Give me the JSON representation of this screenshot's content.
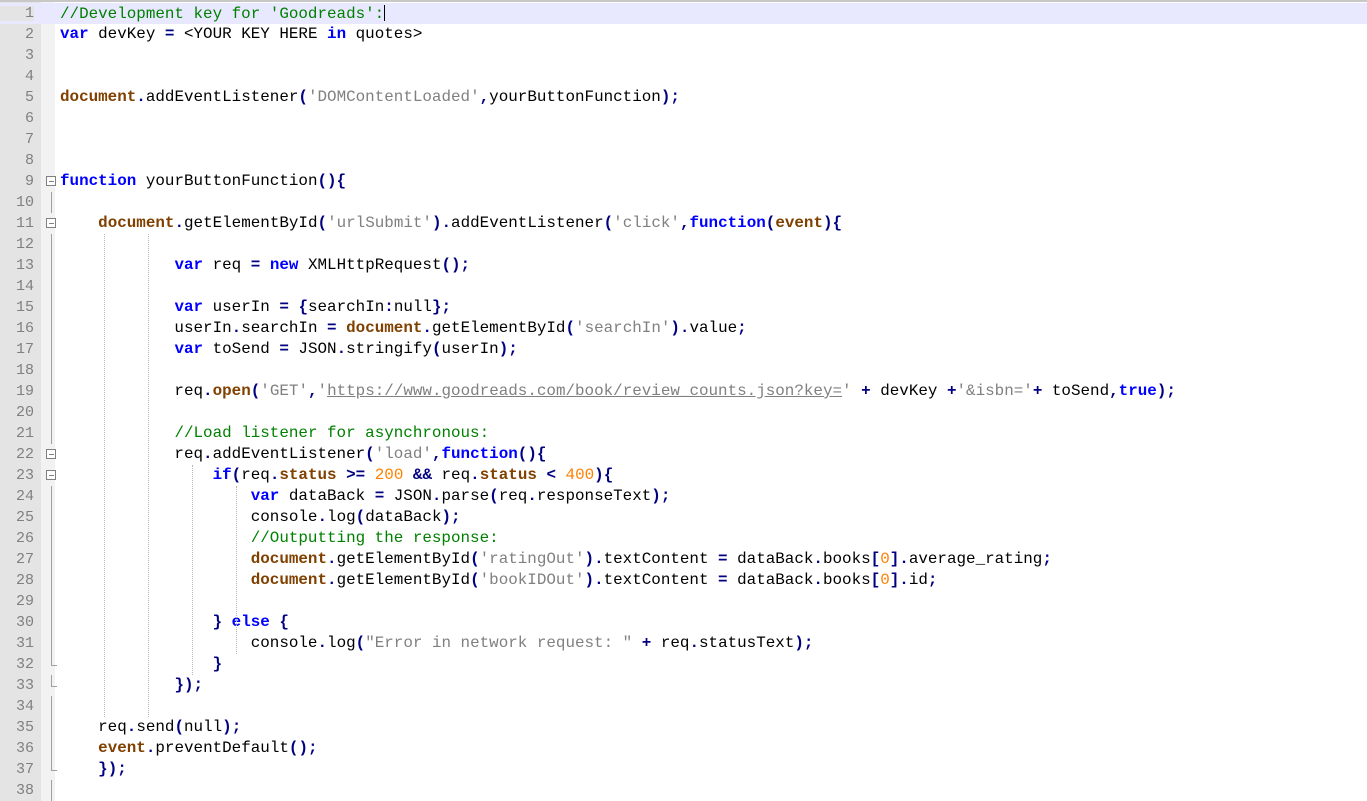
{
  "editor": {
    "language": "javascript",
    "current_line": 1,
    "colors": {
      "keyword": "#0000ff",
      "object": "#804000",
      "string": "#808080",
      "comment": "#008000",
      "number": "#ff8000",
      "operator": "#000080",
      "gutter": "#e4e4e4",
      "current_line": "#e8e8ff"
    },
    "lines": [
      {
        "num": "1",
        "fold": "",
        "tokens": [
          [
            "com",
            "//Development key for 'Goodreads':"
          ]
        ]
      },
      {
        "num": "2",
        "fold": "",
        "tokens": [
          [
            "kw",
            "var"
          ],
          [
            "plain",
            " devKey "
          ],
          [
            "op",
            "="
          ],
          [
            "plain",
            " <YOUR KEY HERE "
          ],
          [
            "kw",
            "in"
          ],
          [
            "plain",
            " quotes>"
          ]
        ]
      },
      {
        "num": "3",
        "fold": "",
        "tokens": []
      },
      {
        "num": "4",
        "fold": "",
        "tokens": []
      },
      {
        "num": "5",
        "fold": "",
        "tokens": [
          [
            "obj",
            "document"
          ],
          [
            "op",
            "."
          ],
          [
            "plain",
            "addEventListener"
          ],
          [
            "op",
            "("
          ],
          [
            "str",
            "'DOMContentLoaded'"
          ],
          [
            "op",
            ","
          ],
          [
            "plain",
            "yourButtonFunction"
          ],
          [
            "op",
            ");"
          ]
        ]
      },
      {
        "num": "6",
        "fold": "",
        "tokens": []
      },
      {
        "num": "7",
        "fold": "",
        "tokens": []
      },
      {
        "num": "8",
        "fold": "",
        "tokens": []
      },
      {
        "num": "9",
        "fold": "box",
        "tokens": [
          [
            "kw",
            "function"
          ],
          [
            "plain",
            " yourButtonFunction"
          ],
          [
            "op",
            "(){"
          ]
        ]
      },
      {
        "num": "10",
        "fold": "line",
        "tokens": []
      },
      {
        "num": "11",
        "fold": "box",
        "tokens": [
          [
            "plain",
            "    "
          ],
          [
            "obj",
            "document"
          ],
          [
            "op",
            "."
          ],
          [
            "plain",
            "getElementById"
          ],
          [
            "op",
            "("
          ],
          [
            "str",
            "'urlSubmit'"
          ],
          [
            "op",
            ")."
          ],
          [
            "plain",
            "addEventListener"
          ],
          [
            "op",
            "("
          ],
          [
            "str",
            "'click'"
          ],
          [
            "op",
            ","
          ],
          [
            "kw",
            "function"
          ],
          [
            "op",
            "("
          ],
          [
            "obj",
            "event"
          ],
          [
            "op",
            "){"
          ]
        ]
      },
      {
        "num": "12",
        "fold": "line",
        "tokens": []
      },
      {
        "num": "13",
        "fold": "line",
        "tokens": [
          [
            "plain",
            "            "
          ],
          [
            "kw",
            "var"
          ],
          [
            "plain",
            " req "
          ],
          [
            "op",
            "="
          ],
          [
            "plain",
            " "
          ],
          [
            "kw",
            "new"
          ],
          [
            "plain",
            " XMLHttpRequest"
          ],
          [
            "op",
            "();"
          ]
        ]
      },
      {
        "num": "14",
        "fold": "line",
        "tokens": []
      },
      {
        "num": "15",
        "fold": "line",
        "tokens": [
          [
            "plain",
            "            "
          ],
          [
            "kw",
            "var"
          ],
          [
            "plain",
            " userIn "
          ],
          [
            "op",
            "="
          ],
          [
            "plain",
            " "
          ],
          [
            "op",
            "{"
          ],
          [
            "plain",
            "searchIn"
          ],
          [
            "op",
            ":"
          ],
          [
            "plain",
            "null"
          ],
          [
            "op",
            "};"
          ]
        ]
      },
      {
        "num": "16",
        "fold": "line",
        "tokens": [
          [
            "plain",
            "            userIn"
          ],
          [
            "op",
            "."
          ],
          [
            "plain",
            "searchIn "
          ],
          [
            "op",
            "="
          ],
          [
            "plain",
            " "
          ],
          [
            "obj",
            "document"
          ],
          [
            "op",
            "."
          ],
          [
            "plain",
            "getElementById"
          ],
          [
            "op",
            "("
          ],
          [
            "str",
            "'searchIn'"
          ],
          [
            "op",
            ")."
          ],
          [
            "plain",
            "value"
          ],
          [
            "op",
            ";"
          ]
        ]
      },
      {
        "num": "17",
        "fold": "line",
        "tokens": [
          [
            "plain",
            "            "
          ],
          [
            "kw",
            "var"
          ],
          [
            "plain",
            " toSend "
          ],
          [
            "op",
            "="
          ],
          [
            "plain",
            " JSON"
          ],
          [
            "op",
            "."
          ],
          [
            "plain",
            "stringify"
          ],
          [
            "op",
            "("
          ],
          [
            "plain",
            "userIn"
          ],
          [
            "op",
            ");"
          ]
        ]
      },
      {
        "num": "18",
        "fold": "line",
        "tokens": []
      },
      {
        "num": "19",
        "fold": "line",
        "tokens": [
          [
            "plain",
            "            req"
          ],
          [
            "op",
            "."
          ],
          [
            "obj",
            "open"
          ],
          [
            "op",
            "("
          ],
          [
            "str",
            "'GET'"
          ],
          [
            "op",
            ","
          ],
          [
            "str",
            "'"
          ],
          [
            "url",
            "https://www.goodreads.com/book/review_counts.json?key="
          ],
          [
            "str",
            "'"
          ],
          [
            "plain",
            " "
          ],
          [
            "op",
            "+"
          ],
          [
            "plain",
            " devKey "
          ],
          [
            "op",
            "+"
          ],
          [
            "str",
            "'&isbn='"
          ],
          [
            "op",
            "+"
          ],
          [
            "plain",
            " toSend"
          ],
          [
            "op",
            ","
          ],
          [
            "kw",
            "true"
          ],
          [
            "op",
            ");"
          ]
        ]
      },
      {
        "num": "20",
        "fold": "line",
        "tokens": []
      },
      {
        "num": "21",
        "fold": "line",
        "tokens": [
          [
            "plain",
            "            "
          ],
          [
            "com",
            "//Load listener for asynchronous:"
          ]
        ]
      },
      {
        "num": "22",
        "fold": "box",
        "tokens": [
          [
            "plain",
            "            req"
          ],
          [
            "op",
            "."
          ],
          [
            "plain",
            "addEventListener"
          ],
          [
            "op",
            "("
          ],
          [
            "str",
            "'load'"
          ],
          [
            "op",
            ","
          ],
          [
            "kw",
            "function"
          ],
          [
            "op",
            "(){"
          ]
        ]
      },
      {
        "num": "23",
        "fold": "box",
        "tokens": [
          [
            "plain",
            "                "
          ],
          [
            "kw",
            "if"
          ],
          [
            "op",
            "("
          ],
          [
            "plain",
            "req"
          ],
          [
            "op",
            "."
          ],
          [
            "obj",
            "status"
          ],
          [
            "plain",
            " "
          ],
          [
            "op",
            ">="
          ],
          [
            "plain",
            " "
          ],
          [
            "num",
            "200"
          ],
          [
            "plain",
            " "
          ],
          [
            "op",
            "&&"
          ],
          [
            "plain",
            " req"
          ],
          [
            "op",
            "."
          ],
          [
            "obj",
            "status"
          ],
          [
            "plain",
            " "
          ],
          [
            "op",
            "<"
          ],
          [
            "plain",
            " "
          ],
          [
            "num",
            "400"
          ],
          [
            "op",
            "){"
          ]
        ]
      },
      {
        "num": "24",
        "fold": "line",
        "tokens": [
          [
            "plain",
            "                    "
          ],
          [
            "kw",
            "var"
          ],
          [
            "plain",
            " dataBack "
          ],
          [
            "op",
            "="
          ],
          [
            "plain",
            " JSON"
          ],
          [
            "op",
            "."
          ],
          [
            "plain",
            "parse"
          ],
          [
            "op",
            "("
          ],
          [
            "plain",
            "req"
          ],
          [
            "op",
            "."
          ],
          [
            "plain",
            "responseText"
          ],
          [
            "op",
            ");"
          ]
        ]
      },
      {
        "num": "25",
        "fold": "line",
        "tokens": [
          [
            "plain",
            "                    console"
          ],
          [
            "op",
            "."
          ],
          [
            "plain",
            "log"
          ],
          [
            "op",
            "("
          ],
          [
            "plain",
            "dataBack"
          ],
          [
            "op",
            ");"
          ]
        ]
      },
      {
        "num": "26",
        "fold": "line",
        "tokens": [
          [
            "plain",
            "                    "
          ],
          [
            "com",
            "//Outputting the response:"
          ]
        ]
      },
      {
        "num": "27",
        "fold": "line",
        "tokens": [
          [
            "plain",
            "                    "
          ],
          [
            "obj",
            "document"
          ],
          [
            "op",
            "."
          ],
          [
            "plain",
            "getElementById"
          ],
          [
            "op",
            "("
          ],
          [
            "str",
            "'ratingOut'"
          ],
          [
            "op",
            ")."
          ],
          [
            "plain",
            "textContent "
          ],
          [
            "op",
            "="
          ],
          [
            "plain",
            " dataBack"
          ],
          [
            "op",
            "."
          ],
          [
            "plain",
            "books"
          ],
          [
            "op",
            "["
          ],
          [
            "num",
            "0"
          ],
          [
            "op",
            "]."
          ],
          [
            "plain",
            "average_rating"
          ],
          [
            "op",
            ";"
          ]
        ]
      },
      {
        "num": "28",
        "fold": "line",
        "tokens": [
          [
            "plain",
            "                    "
          ],
          [
            "obj",
            "document"
          ],
          [
            "op",
            "."
          ],
          [
            "plain",
            "getElementById"
          ],
          [
            "op",
            "("
          ],
          [
            "str",
            "'bookIDOut'"
          ],
          [
            "op",
            ")."
          ],
          [
            "plain",
            "textContent "
          ],
          [
            "op",
            "="
          ],
          [
            "plain",
            " dataBack"
          ],
          [
            "op",
            "."
          ],
          [
            "plain",
            "books"
          ],
          [
            "op",
            "["
          ],
          [
            "num",
            "0"
          ],
          [
            "op",
            "]."
          ],
          [
            "plain",
            "id"
          ],
          [
            "op",
            ";"
          ]
        ]
      },
      {
        "num": "29",
        "fold": "line",
        "tokens": []
      },
      {
        "num": "30",
        "fold": "line",
        "tokens": [
          [
            "plain",
            "                "
          ],
          [
            "op",
            "}"
          ],
          [
            "plain",
            " "
          ],
          [
            "kw",
            "else"
          ],
          [
            "plain",
            " "
          ],
          [
            "op",
            "{"
          ]
        ]
      },
      {
        "num": "31",
        "fold": "line",
        "tokens": [
          [
            "plain",
            "                    console"
          ],
          [
            "op",
            "."
          ],
          [
            "plain",
            "log"
          ],
          [
            "op",
            "("
          ],
          [
            "str",
            "\"Error in network request: \""
          ],
          [
            "plain",
            " "
          ],
          [
            "op",
            "+"
          ],
          [
            "plain",
            " req"
          ],
          [
            "op",
            "."
          ],
          [
            "plain",
            "statusText"
          ],
          [
            "op",
            ");"
          ]
        ]
      },
      {
        "num": "32",
        "fold": "end",
        "tokens": [
          [
            "plain",
            "                "
          ],
          [
            "op",
            "}"
          ]
        ]
      },
      {
        "num": "33",
        "fold": "end",
        "tokens": [
          [
            "plain",
            "            "
          ],
          [
            "op",
            "});"
          ]
        ]
      },
      {
        "num": "34",
        "fold": "line",
        "tokens": []
      },
      {
        "num": "35",
        "fold": "line",
        "tokens": [
          [
            "plain",
            "    req"
          ],
          [
            "op",
            "."
          ],
          [
            "plain",
            "send"
          ],
          [
            "op",
            "("
          ],
          [
            "plain",
            "null"
          ],
          [
            "op",
            ");"
          ]
        ]
      },
      {
        "num": "36",
        "fold": "line",
        "tokens": [
          [
            "plain",
            "    "
          ],
          [
            "obj",
            "event"
          ],
          [
            "op",
            "."
          ],
          [
            "plain",
            "preventDefault"
          ],
          [
            "op",
            "();"
          ]
        ]
      },
      {
        "num": "37",
        "fold": "end",
        "tokens": [
          [
            "plain",
            "    "
          ],
          [
            "op",
            "});"
          ]
        ]
      },
      {
        "num": "38",
        "fold": "line",
        "tokens": []
      }
    ]
  }
}
